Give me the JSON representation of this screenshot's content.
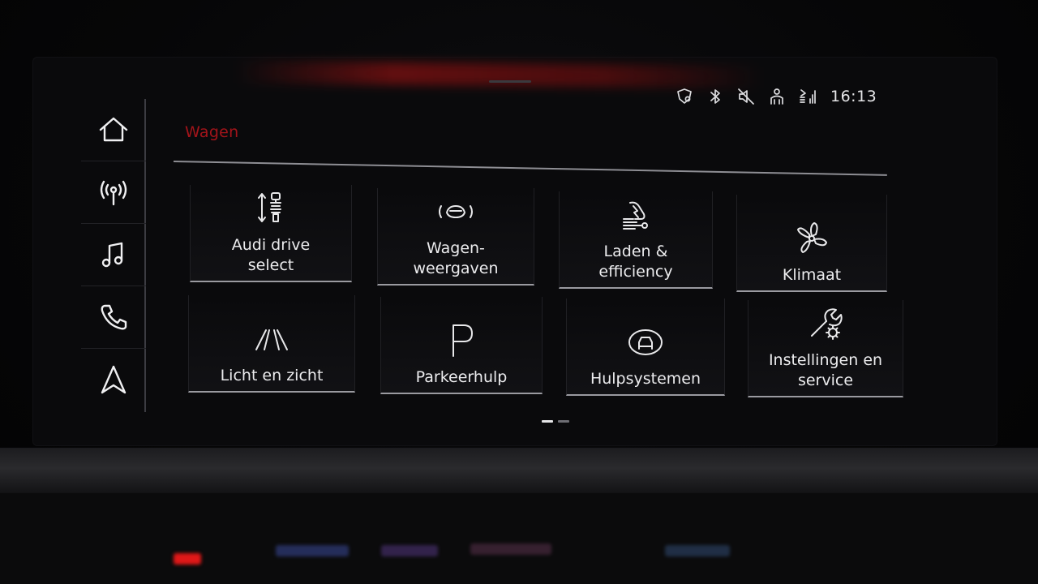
{
  "status": {
    "time": "16:13",
    "icons": [
      "navigation-alert-icon",
      "bluetooth-icon",
      "mute-icon",
      "profile-icon",
      "lte-signal-icon"
    ]
  },
  "sidebar": {
    "items": [
      {
        "name": "home",
        "icon": "home-icon"
      },
      {
        "name": "radio",
        "icon": "radio-antenna-icon"
      },
      {
        "name": "media",
        "icon": "music-note-icon"
      },
      {
        "name": "phone",
        "icon": "phone-icon"
      },
      {
        "name": "navigation",
        "icon": "navigation-arrow-icon"
      }
    ]
  },
  "header": {
    "title": "Wagen",
    "accent_color": "#a3141a"
  },
  "tiles": [
    {
      "label": "Audi drive\nselect",
      "icon": "suspension-icon"
    },
    {
      "label": "Wagen-\nweergaven",
      "icon": "car-view-icon"
    },
    {
      "label": "Laden &\nefficiency",
      "icon": "charging-efficiency-icon"
    },
    {
      "label": "Klimaat",
      "icon": "fan-icon"
    },
    {
      "label": "Licht en zicht",
      "icon": "headlight-beam-icon"
    },
    {
      "label": "Parkeerhulp",
      "icon": "parking-icon"
    },
    {
      "label": "Hulpsystemen",
      "icon": "driver-assist-icon"
    },
    {
      "label": "Instellingen en\nservice",
      "icon": "wrench-gear-icon"
    }
  ],
  "pagination": {
    "pages": 2,
    "current": 1
  }
}
